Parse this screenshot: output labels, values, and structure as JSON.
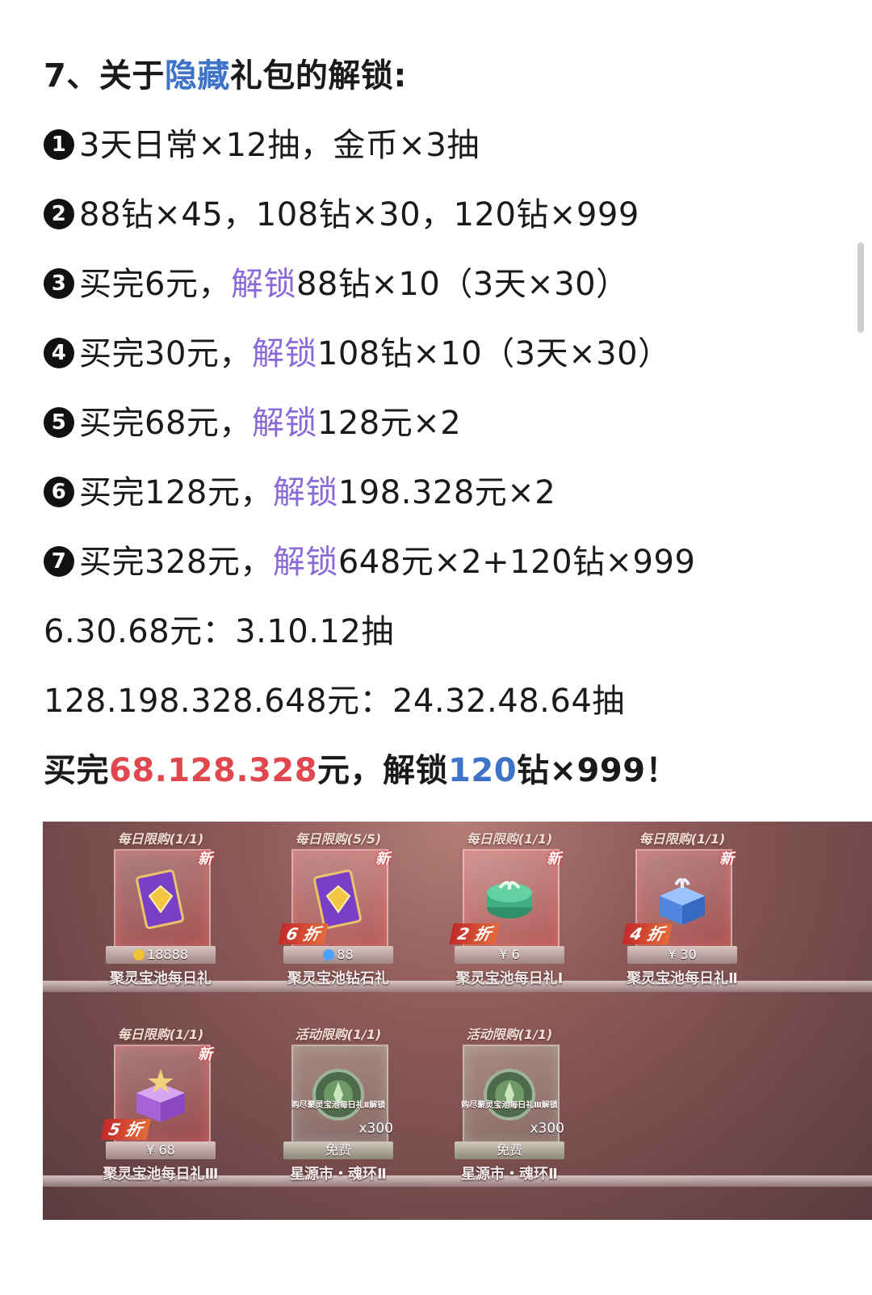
{
  "heading": {
    "prefix": "7、关于",
    "highlight": "隐藏",
    "suffix": "礼包的解锁:"
  },
  "items": [
    {
      "marker": "1",
      "parts": [
        {
          "t": "3天日常×12抽，金币×3抽",
          "c": ""
        }
      ]
    },
    {
      "marker": "2",
      "parts": [
        {
          "t": "88钻×45，108钻×30，120钻×999",
          "c": ""
        }
      ]
    },
    {
      "marker": "3",
      "parts": [
        {
          "t": "买完6元，",
          "c": ""
        },
        {
          "t": "解锁",
          "c": "purple"
        },
        {
          "t": "88钻×10（3天×30）",
          "c": ""
        }
      ]
    },
    {
      "marker": "4",
      "parts": [
        {
          "t": "买完30元，",
          "c": ""
        },
        {
          "t": "解锁",
          "c": "purple"
        },
        {
          "t": "108钻×10（3天×30）",
          "c": ""
        }
      ]
    },
    {
      "marker": "5",
      "parts": [
        {
          "t": "买完68元，",
          "c": ""
        },
        {
          "t": "解锁",
          "c": "purple"
        },
        {
          "t": "128元×2",
          "c": ""
        }
      ]
    },
    {
      "marker": "6",
      "parts": [
        {
          "t": "买完128元，",
          "c": ""
        },
        {
          "t": "解锁",
          "c": "purple"
        },
        {
          "t": "198.328元×2",
          "c": ""
        }
      ]
    },
    {
      "marker": "7",
      "parts": [
        {
          "t": "买完328元，",
          "c": ""
        },
        {
          "t": "解锁",
          "c": "purple"
        },
        {
          "t": "648元×2+120钻×999",
          "c": ""
        }
      ]
    }
  ],
  "summary": [
    "6.30.68元：3.10.12抽",
    "128.198.328.648元：24.32.48.64抽"
  ],
  "conclusion": [
    {
      "t": "买完",
      "c": ""
    },
    {
      "t": "68.128.328",
      "c": "red"
    },
    {
      "t": "元，解锁",
      "c": ""
    },
    {
      "t": "120",
      "c": "blue"
    },
    {
      "t": "钻×999！",
      "c": ""
    }
  ],
  "colors": {
    "purple": "#8a6ad8",
    "blue": "#3d73c9",
    "red": "#e0474f"
  },
  "shop": {
    "cards": [
      {
        "limit": "每日限购(1/1)",
        "new": "新",
        "discount": "",
        "price": "18888",
        "price_icon": "gold-coin-icon",
        "name": "聚灵宝池每日礼",
        "item": "purple-diamond-card-icon",
        "style": "red"
      },
      {
        "limit": "每日限购(5/5)",
        "new": "新",
        "discount": "6 折",
        "price": "88",
        "price_icon": "blue-diamond-icon",
        "name": "聚灵宝池钻石礼",
        "item": "purple-diamond-card-icon",
        "style": "red"
      },
      {
        "limit": "每日限购(1/1)",
        "new": "新",
        "discount": "2 折",
        "price": "¥ 6",
        "price_icon": "",
        "name": "聚灵宝池每日礼Ⅰ",
        "item": "green-gift-box-icon",
        "style": "red"
      },
      {
        "limit": "每日限购(1/1)",
        "new": "新",
        "discount": "4 折",
        "price": "¥ 30",
        "price_icon": "",
        "name": "聚灵宝池每日礼Ⅱ",
        "item": "blue-gift-box-icon",
        "style": "red"
      },
      {
        "limit": "每日限购(1/1)",
        "new": "新",
        "discount": "5 折",
        "price": "¥ 68",
        "price_icon": "",
        "name": "聚灵宝池每日礼Ⅲ",
        "item": "purple-gift-box-icon",
        "style": "red"
      },
      {
        "limit": "活动限购(1/1)",
        "new": "",
        "discount": "",
        "price": "免费",
        "price_icon": "",
        "name": "星源市・魂环Ⅱ",
        "item": "soul-ring-coin-icon",
        "unlock_note": "购尽聚灵宝池每日礼Ⅱ解锁",
        "qty": "x300",
        "style": "gray"
      },
      {
        "limit": "活动限购(1/1)",
        "new": "",
        "discount": "",
        "price": "免费",
        "price_icon": "",
        "name": "星源市・魂环Ⅱ",
        "item": "soul-ring-coin-icon",
        "unlock_note": "购尽聚灵宝池每日礼Ⅲ解锁",
        "qty": "x300",
        "style": "gray"
      }
    ]
  }
}
